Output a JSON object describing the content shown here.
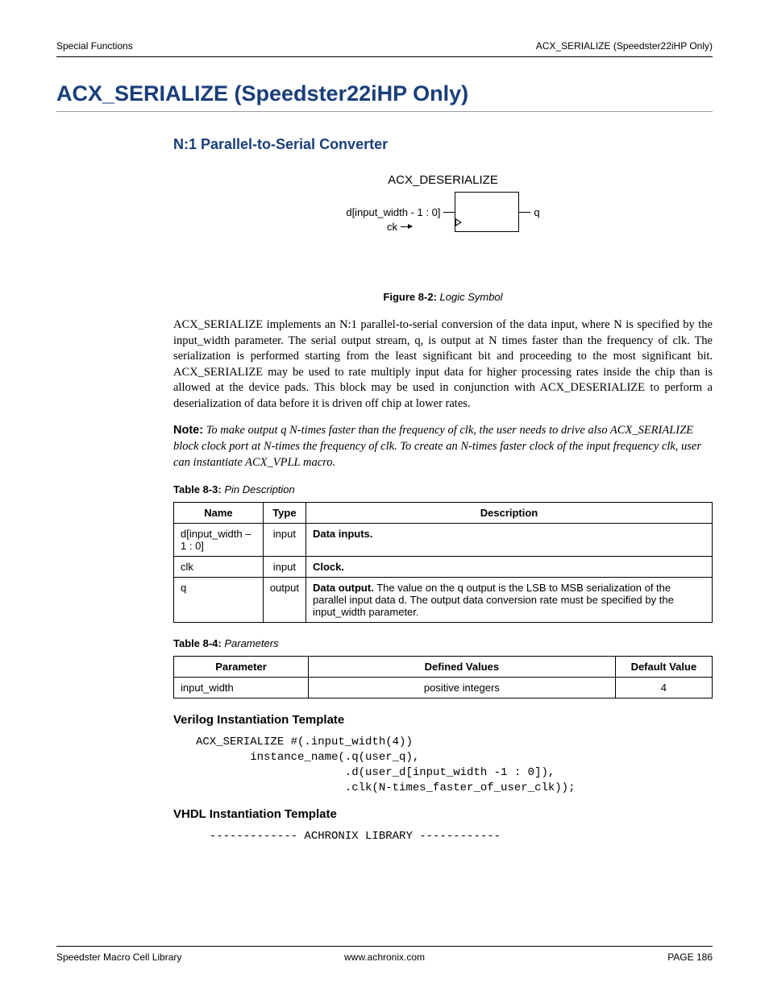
{
  "header": {
    "left": "Special Functions",
    "right": "ACX_SERIALIZE (Speedster22iHP Only)"
  },
  "title": "ACX_SERIALIZE (Speedster22iHP Only)",
  "subtitle": "N:1 Parallel-to-Serial Converter",
  "diagram": {
    "title": "ACX_DESERIALIZE",
    "port_d": "d[input_width - 1 : 0]",
    "port_q": "q",
    "port_ck": "ck"
  },
  "figure_caption": {
    "label": "Figure 8-2:",
    "text": "Logic Symbol"
  },
  "paragraph": "ACX_SERIALIZE implements an N:1 parallel-to-serial conversion of the data input, where N is specified by the input_width parameter. The serial output stream, q, is output at N times faster than the frequency of clk. The serialization is performed starting from the least significant bit and proceeding to the most significant bit. ACX_SERIALIZE may be used to rate multiply input data for higher processing rates inside the chip than is allowed at the device pads. This block may be used in conjunction with ACX_DESERIALIZE to perform a deserialization of data before it is driven off chip at lower rates.",
  "note": {
    "label": "Note:",
    "text": "To make output q N-times faster than the frequency of clk, the user needs to drive also ACX_SERIALIZE block clock port at N-times the frequency of clk. To create an N-times faster clock of the input frequency clk, user can instantiate ACX_VPLL macro."
  },
  "table1": {
    "caption_label": "Table 8-3:",
    "caption_text": "Pin Description",
    "headers": [
      "Name",
      "Type",
      "Description"
    ],
    "rows": [
      {
        "name": "d[input_width –1 : 0]",
        "type": "input",
        "desc_bold": "Data inputs.",
        "desc_rest": ""
      },
      {
        "name": "clk",
        "type": "input",
        "desc_bold": "Clock.",
        "desc_rest": ""
      },
      {
        "name": "q",
        "type": "output",
        "desc_bold": "Data output.",
        "desc_rest": " The value on the q output is the LSB to MSB serialization of the parallel input data d. The output data conversion rate must be specified by the input_width parameter."
      }
    ]
  },
  "table2": {
    "caption_label": "Table 8-4:",
    "caption_text": "Parameters",
    "headers": [
      "Parameter",
      "Defined Values",
      "Default Value"
    ],
    "rows": [
      {
        "param": "input_width",
        "defined": "positive integers",
        "default": "4"
      }
    ]
  },
  "verilog_heading": "Verilog Instantiation Template",
  "verilog_code": "ACX_SERIALIZE #(.input_width(4))\n        instance_name(.q(user_q),\n                      .d(user_d[input_width -1 : 0]),\n                      .clk(N-times_faster_of_user_clk));",
  "vhdl_heading": "VHDL Instantiation Template",
  "vhdl_code": "  ------------- ACHRONIX LIBRARY ------------",
  "footer": {
    "left": "Speedster Macro Cell Library",
    "center": "www.achronix.com",
    "right": "PAGE 186"
  }
}
